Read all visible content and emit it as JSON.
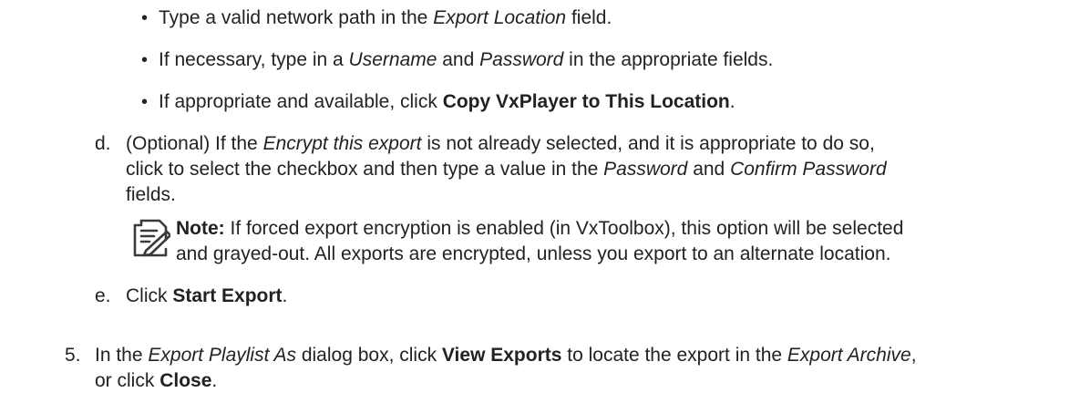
{
  "bullets": [
    {
      "pre": "Type a valid network path in the ",
      "em": "Export Location",
      "post": " field."
    },
    {
      "pre": "If necessary, type in a ",
      "em1": "Username",
      "mid": " and ",
      "em2": "Password",
      "post": " in the appropriate fields."
    },
    {
      "pre": "If appropriate and available, click ",
      "strong": "Copy VxPlayer to This Location",
      "post": "."
    }
  ],
  "step_d": {
    "marker": "d.",
    "l1_pre": "(Optional) If the ",
    "l1_em": "Encrypt this export",
    "l1_post": " is not already selected, and it is appropriate to do so,",
    "l2_pre": "click to select the checkbox and then type a value in the ",
    "l2_em1": "Password",
    "l2_mid": " and ",
    "l2_em2": "Confirm Password",
    "l3": "fields."
  },
  "note": {
    "icon": "note-icon",
    "label": "Note:",
    "l1": " If forced export encryption is enabled (in VxToolbox), this option will be selected",
    "l2": "and grayed-out. All exports are encrypted, unless you export to an alternate location."
  },
  "step_e": {
    "marker": "e.",
    "pre": "Click ",
    "strong": "Start Export",
    "post": "."
  },
  "step_5": {
    "marker": "5.",
    "l1_pre": "In the ",
    "l1_em1": "Export Playlist As",
    "l1_mid1": " dialog box, click ",
    "l1_strong": "View Exports",
    "l1_mid2": " to locate the export in the ",
    "l1_em2": "Export Archive",
    "l1_post": ",",
    "l2_pre": "or click ",
    "l2_strong": "Close",
    "l2_post": "."
  }
}
